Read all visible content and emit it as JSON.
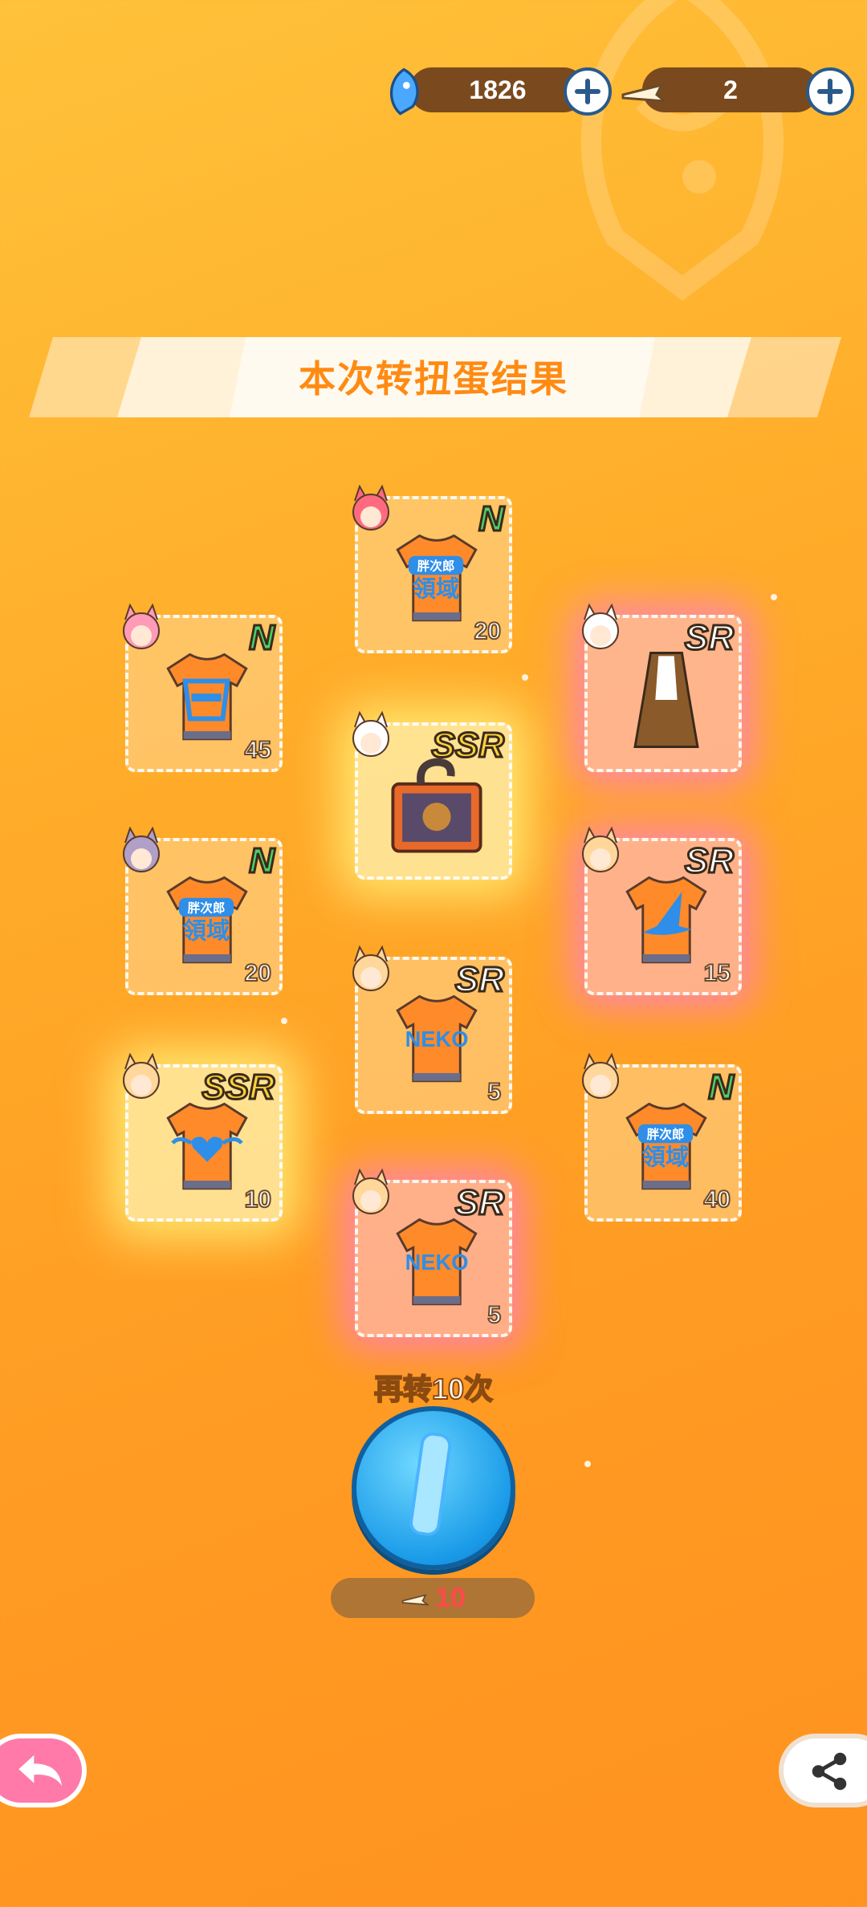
{
  "currencies": [
    {
      "name": "blue-fish-gem",
      "value": "1826"
    },
    {
      "name": "fish-bone-ticket",
      "value": "2"
    }
  ],
  "banner": {
    "title": "本次转扭蛋结果"
  },
  "results": [
    {
      "rarity": "N",
      "qty": "20",
      "item": "shirt-text",
      "glow": "none"
    },
    {
      "rarity": "N",
      "qty": "45",
      "item": "shirt-kimono",
      "glow": "none"
    },
    {
      "rarity": "SR",
      "qty": "",
      "item": "dress-costume",
      "glow": "sr"
    },
    {
      "rarity": "SSR",
      "qty": "",
      "item": "treasure-box",
      "glow": "ssr"
    },
    {
      "rarity": "N",
      "qty": "20",
      "item": "shirt-text",
      "glow": "none"
    },
    {
      "rarity": "SR",
      "qty": "15",
      "item": "shirt-witch-hat",
      "glow": "sr"
    },
    {
      "rarity": "SR",
      "qty": "5",
      "item": "shirt-neko",
      "glow": "none"
    },
    {
      "rarity": "SSR",
      "qty": "10",
      "item": "shirt-wing-heart",
      "glow": "ssr"
    },
    {
      "rarity": "N",
      "qty": "40",
      "item": "shirt-text",
      "glow": "none"
    },
    {
      "rarity": "SR",
      "qty": "5",
      "item": "shirt-neko",
      "glow": "sr"
    }
  ],
  "shirt_text_label": [
    "胖次郎",
    "領域"
  ],
  "neko_label": "NEKO",
  "spin_again": {
    "label": "再转10次",
    "cost": "10"
  },
  "colors": {
    "background": "#ffa628",
    "accent": "#ff8a12",
    "spin_button": "#1a9be8"
  }
}
